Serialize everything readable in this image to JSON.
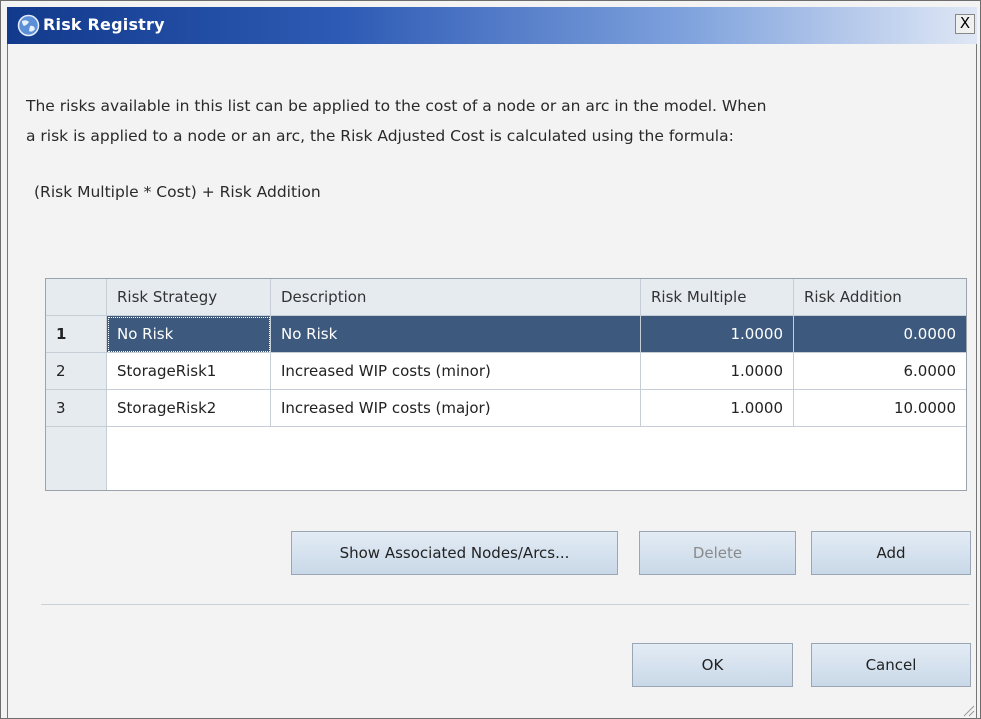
{
  "window": {
    "title": "Risk Registry",
    "close_label": "X"
  },
  "description": {
    "line1": "The risks available in this list can be applied to the cost of a node or an arc in the model. When",
    "line2": "a risk is applied to a node or an arc, the Risk Adjusted Cost is calculated using the formula:",
    "formula": "(Risk Multiple * Cost) + Risk Addition"
  },
  "table": {
    "columns": [
      "Risk Strategy",
      "Description",
      "Risk Multiple",
      "Risk Addition"
    ],
    "rows": [
      {
        "num": "1",
        "strategy": "No Risk",
        "description": "No Risk",
        "multiple": "1.0000",
        "addition": "0.0000",
        "selected": true
      },
      {
        "num": "2",
        "strategy": "StorageRisk1",
        "description": "Increased WIP costs (minor)",
        "multiple": "1.0000",
        "addition": "6.0000",
        "selected": false
      },
      {
        "num": "3",
        "strategy": "StorageRisk2",
        "description": "Increased WIP costs (major)",
        "multiple": "1.0000",
        "addition": "10.0000",
        "selected": false
      }
    ]
  },
  "buttons": {
    "show_associated": "Show Associated Nodes/Arcs...",
    "delete": "Delete",
    "add": "Add",
    "ok": "OK",
    "cancel": "Cancel"
  },
  "colors": {
    "title_bar_start": "#123a8c",
    "selection": "#3d5a7e",
    "header_bg": "#e6ebf0",
    "button_bg": "#d5e1ee"
  },
  "icons": {
    "title": "globe-icon",
    "resize": "resize-grip-icon"
  }
}
